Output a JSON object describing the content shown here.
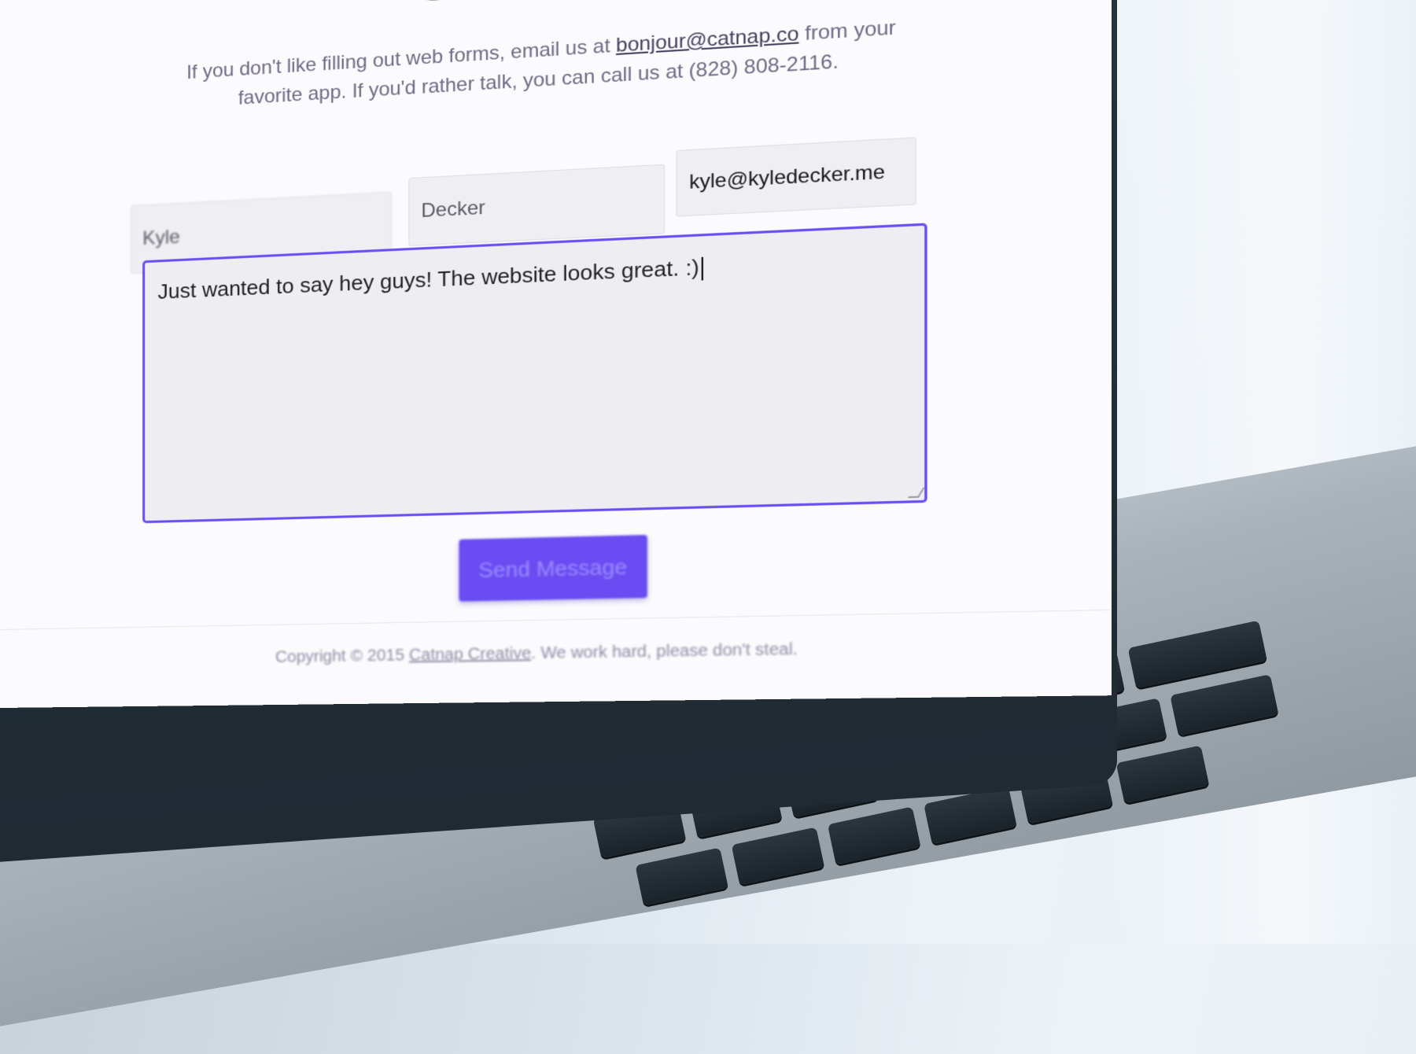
{
  "page": {
    "title": "Contact",
    "intro_part1": "If you don't like filling out web forms, email us at ",
    "intro_email": "bonjour@catnap.co",
    "intro_part2": " from your favorite app. If you'd rather talk, you can call us at (828) 808-2116."
  },
  "form": {
    "first_name_value": "Kyle",
    "last_name_value": "Decker",
    "email_value": "kyle@kyledecker.me",
    "message_value": "Just wanted to say hey guys! The website looks great. :)",
    "submit_label": "Send Message"
  },
  "footer": {
    "prefix": "Copyright © 2015 ",
    "company": "Catnap Creative",
    "suffix": ". We work hard, please don't steal."
  },
  "colors": {
    "accent": "#6a4cf2",
    "focus_border": "#6b4ef3",
    "bezel": "#222c35"
  }
}
